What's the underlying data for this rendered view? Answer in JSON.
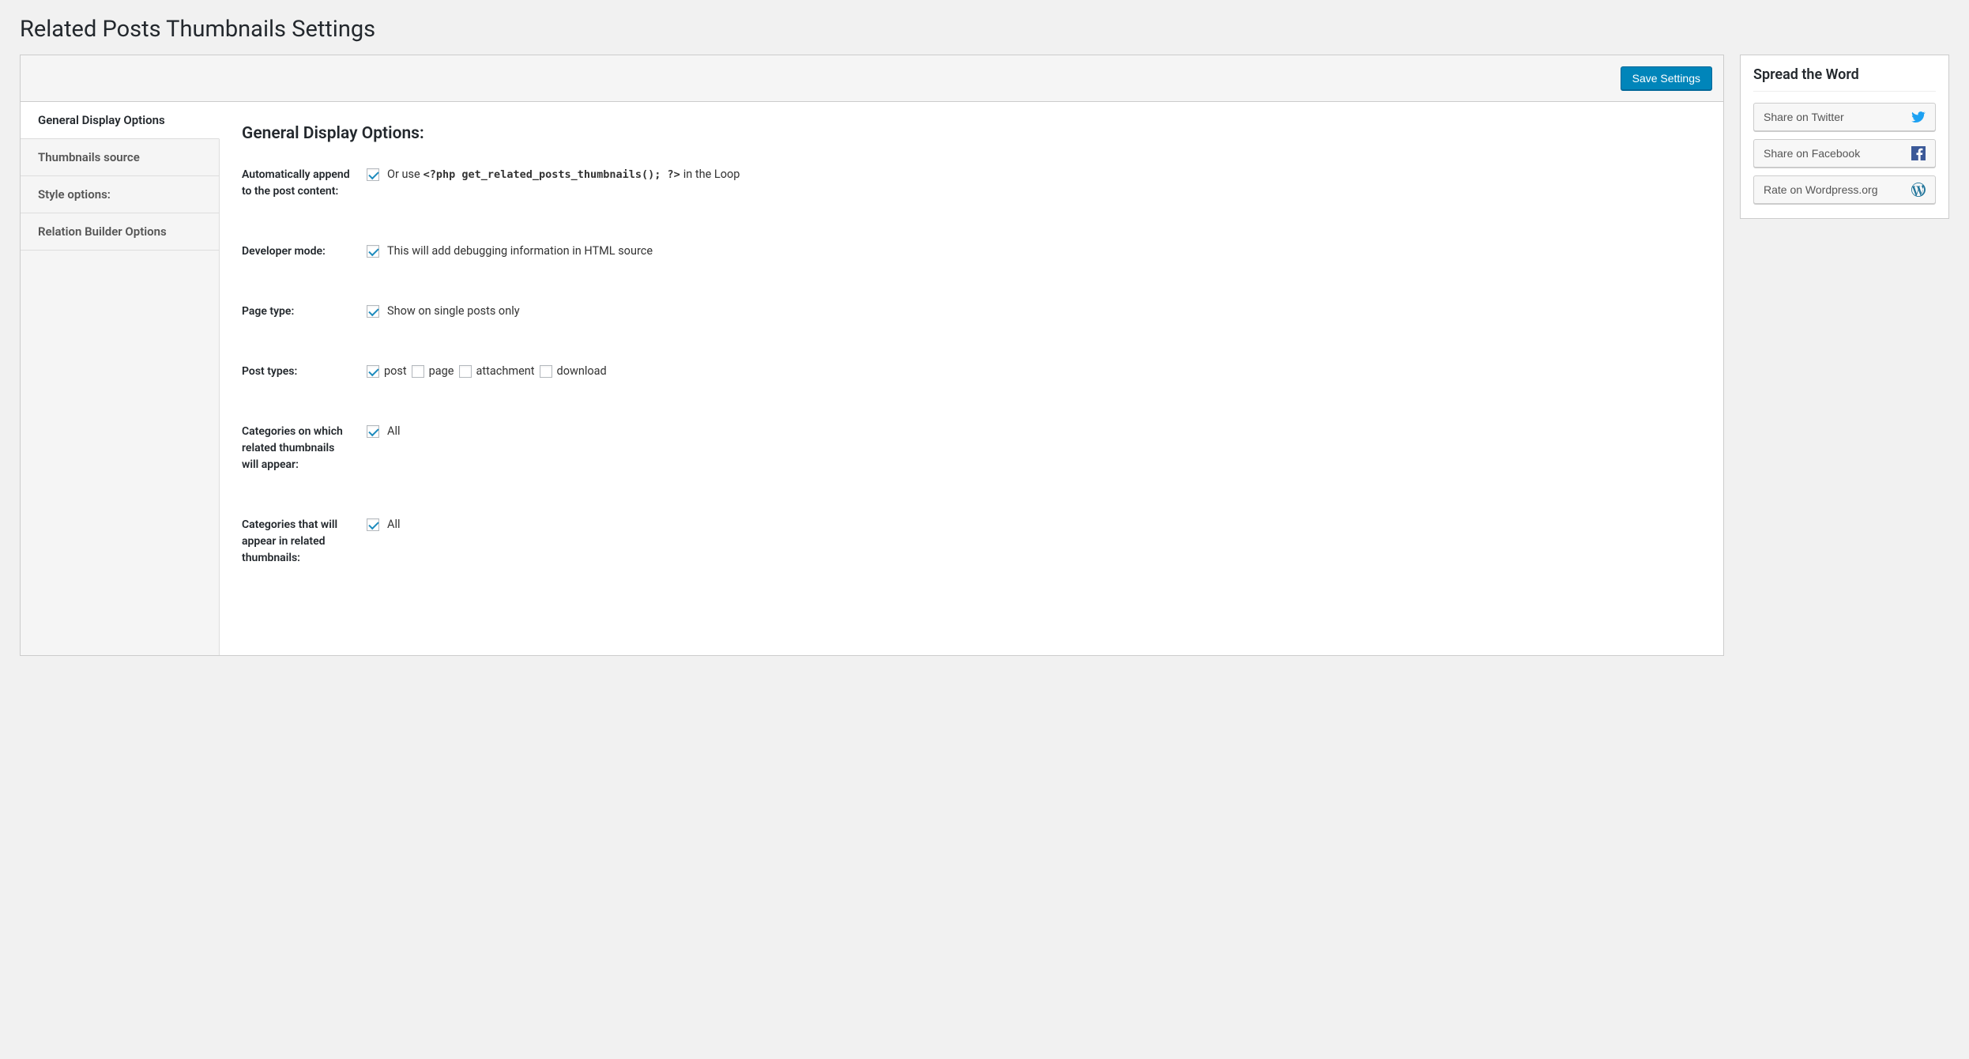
{
  "page": {
    "title": "Related Posts Thumbnails Settings"
  },
  "toolbar": {
    "save_label": "Save Settings"
  },
  "tabs": {
    "items": [
      {
        "label": "General Display Options",
        "active": true
      },
      {
        "label": "Thumbnails source",
        "active": false
      },
      {
        "label": "Style options:",
        "active": false
      },
      {
        "label": "Relation Builder Options",
        "active": false
      }
    ]
  },
  "panel": {
    "title": "General Display Options:",
    "rows": {
      "auto_append": {
        "label": "Automatically append to the post content:",
        "checked": true,
        "text_before": "Or use ",
        "code": "<?php get_related_posts_thumbnails(); ?>",
        "text_after": " in the Loop"
      },
      "dev_mode": {
        "label": "Developer mode:",
        "checked": true,
        "text": "This will add debugging information in HTML source"
      },
      "page_type": {
        "label": "Page type:",
        "checked": true,
        "text": "Show on single posts only"
      },
      "post_types": {
        "label": "Post types:",
        "options": [
          {
            "label": "post",
            "checked": true
          },
          {
            "label": "page",
            "checked": false
          },
          {
            "label": "attachment",
            "checked": false
          },
          {
            "label": "download",
            "checked": false
          }
        ]
      },
      "cats_on": {
        "label": "Categories on which related thumbnails will appear:",
        "checked": true,
        "text": "All"
      },
      "cats_appear": {
        "label": "Categories that will appear in related thumbnails:",
        "checked": true,
        "text": "All"
      }
    }
  },
  "sidebar": {
    "title": "Spread the Word",
    "buttons": [
      {
        "label": "Share on Twitter",
        "icon": "twitter"
      },
      {
        "label": "Share on Facebook",
        "icon": "facebook"
      },
      {
        "label": "Rate on Wordpress.org",
        "icon": "wordpress"
      }
    ]
  }
}
